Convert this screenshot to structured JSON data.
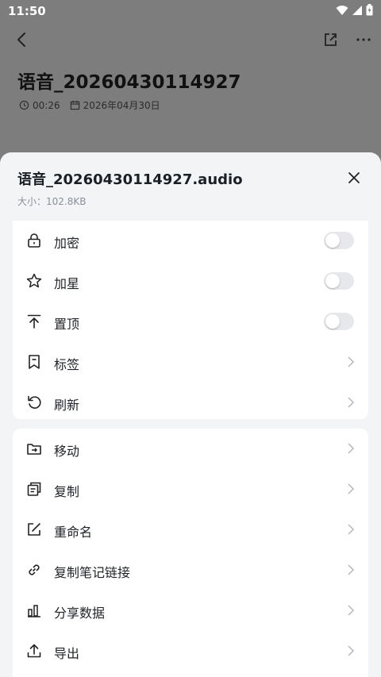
{
  "status": {
    "time": "11:50"
  },
  "note": {
    "title": "语音_20260430114927",
    "duration": "00:26",
    "date": "2026年04月30日"
  },
  "sheet": {
    "title": "语音_20260430114927.audio",
    "size": "大小：102.8KB",
    "group1": [
      {
        "label": "加密",
        "icon": "lock-icon",
        "control": "toggle",
        "on": false
      },
      {
        "label": "加星",
        "icon": "star-icon",
        "control": "toggle",
        "on": false
      },
      {
        "label": "置顶",
        "icon": "pin-top-icon",
        "control": "toggle",
        "on": false
      },
      {
        "label": "标签",
        "icon": "bookmark-icon",
        "control": "chevron"
      },
      {
        "label": "刷新",
        "icon": "refresh-icon",
        "control": "chevron"
      }
    ],
    "group2": [
      {
        "label": "移动",
        "icon": "move-icon",
        "control": "chevron"
      },
      {
        "label": "复制",
        "icon": "copy-icon",
        "control": "chevron"
      },
      {
        "label": "重命名",
        "icon": "rename-icon",
        "control": "chevron"
      },
      {
        "label": "复制笔记链接",
        "icon": "link-icon",
        "control": "chevron"
      },
      {
        "label": "分享数据",
        "icon": "bar-chart-icon",
        "control": "chevron"
      },
      {
        "label": "导出",
        "icon": "export-icon",
        "control": "chevron"
      }
    ]
  }
}
